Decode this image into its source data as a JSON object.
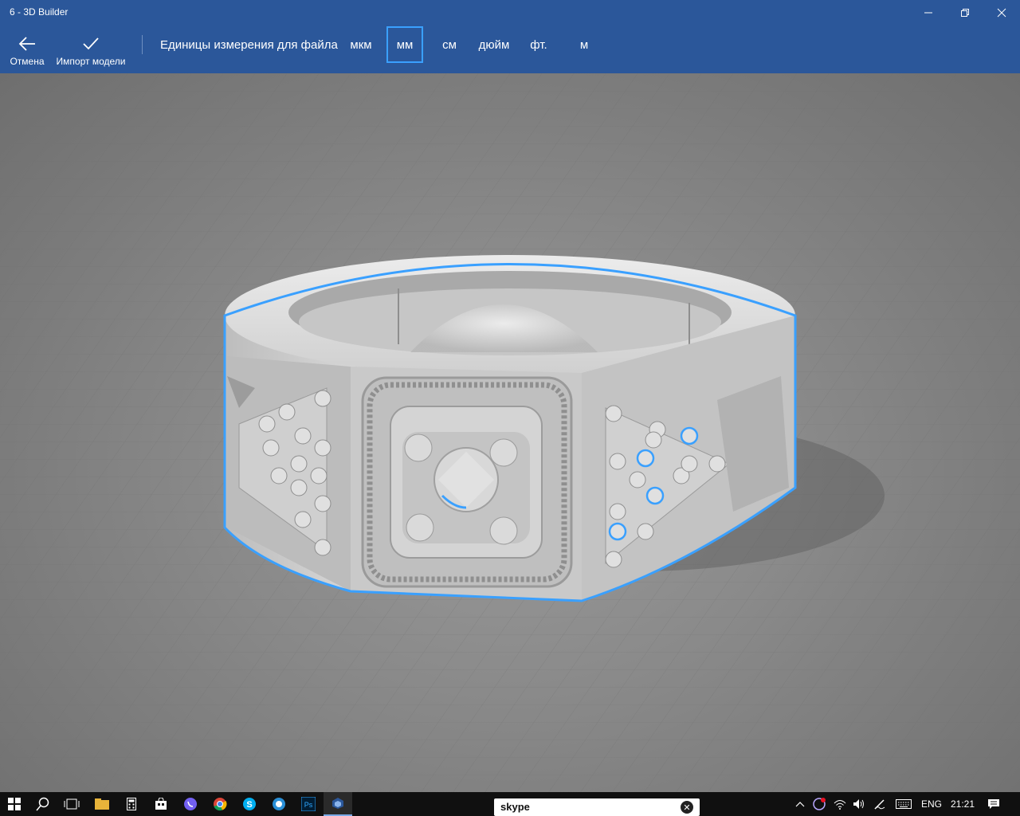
{
  "window": {
    "title": "6 - 3D Builder",
    "minimize_icon": "minimize-icon",
    "maximize_icon": "restore-icon",
    "close_icon": "close-icon"
  },
  "commandbar": {
    "cancel_label": "Отмена",
    "import_label": "Импорт модели",
    "units_label": "Единицы измерения для файла",
    "units": [
      "мкм",
      "мм",
      "см",
      "дюйм",
      "фт.",
      "м"
    ],
    "selected_unit": "мм"
  },
  "colors": {
    "accent": "#2b579a",
    "selection": "#3aa0ff",
    "model": "#d6d6d6"
  },
  "taskbar": {
    "apps": [
      "start-icon",
      "search-icon",
      "task-view-icon",
      "file-explorer-icon",
      "calculator-icon",
      "store-icon",
      "viber-icon",
      "chrome-icon",
      "skype-icon",
      "app-icon",
      "photoshop-icon",
      "3d-builder-icon"
    ],
    "skype_logo": "skype",
    "language": "ENG",
    "time": "21:21"
  }
}
